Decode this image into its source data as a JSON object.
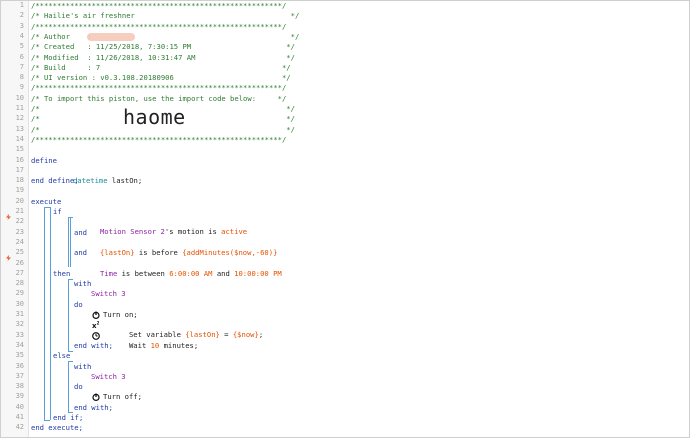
{
  "editor": {
    "line_numbers": [
      "1",
      "2",
      "3",
      "4",
      "5",
      "6",
      "7",
      "8",
      "9",
      "10",
      "11",
      "12",
      "13",
      "14",
      "15",
      "16",
      "17",
      "18",
      "19",
      "20",
      "21",
      "22",
      "23",
      "24",
      "25",
      "26",
      "27",
      "28",
      "29",
      "30",
      "31",
      "32",
      "33",
      "34",
      "35",
      "36",
      "37",
      "38",
      "39",
      "40",
      "41",
      "42"
    ],
    "header": {
      "border": "/*********************************************************/",
      "title": "/* Hailie's air freshner                                    */",
      "author": "/* Author    :                                              */",
      "created": "/* Created   : 11/25/2018, 7:30:15 PM                      */",
      "modified": "/* Modified  : 11/26/2018, 10:31:47 AM                     */",
      "build": "/* Build     : 7                                          */",
      "ui_version": "/* UI version : v0.3.108.20180906                         */",
      "import_note": "/* To import this piston, use the import code below:     */",
      "empty1": "/*                                                         */",
      "empty2": "/*                                                         */",
      "empty3": "/*                                                         */",
      "import_code": "haome"
    },
    "define": {
      "kw_define": "define",
      "type": "datetime",
      "var": "lastOn;",
      "kw_end_define": "end define;"
    },
    "execute": {
      "kw_execute": "execute",
      "kw_if": "if",
      "cond1_device": "Motion Sensor 2",
      "cond1_mid": "'s motion is ",
      "cond1_value": "active",
      "kw_and1": "and",
      "cond2_var": "{lastOn}",
      "cond2_mid": " is before ",
      "cond2_value": "{addMinutes($now,-60)}",
      "kw_and2": "and",
      "cond3_attr": "Time",
      "cond3_mid": " is between ",
      "cond3_v1": "6:00:00 AM",
      "cond3_and": " and ",
      "cond3_v2": "10:00:00 PM",
      "kw_then": "then",
      "kw_with1": "with",
      "device1": "Switch 3",
      "kw_do1": "do",
      "action_turn_on": "Turn on;",
      "action_set_pre": "Set variable ",
      "action_set_var": "{lastOn}",
      "action_set_eq": " = ",
      "action_set_val": "{$now}",
      "action_set_end": ";",
      "action_wait_pre": "Wait ",
      "action_wait_num": "10",
      "action_wait_post": " minutes;",
      "kw_end_with1": "end with;",
      "kw_else": "else",
      "kw_with2": "with",
      "device2": "Switch 3",
      "kw_do2": "do",
      "action_turn_off": "Turn off;",
      "kw_end_with2": "end with;",
      "kw_end_if": "end if;",
      "kw_end_execute": "end execute;"
    },
    "icons": {
      "condition_marker": "lightning-bolt-icon",
      "power_on": "power-icon",
      "variable": "variable-x2-icon",
      "wait": "clock-icon",
      "power_off": "power-off-icon"
    },
    "colors": {
      "comment": "#2e7d32",
      "keyword": "#1f3aa6",
      "type": "#1c8e9e",
      "device": "#8e24aa",
      "value": "#e65100",
      "guide": "#5aa0d8"
    }
  }
}
